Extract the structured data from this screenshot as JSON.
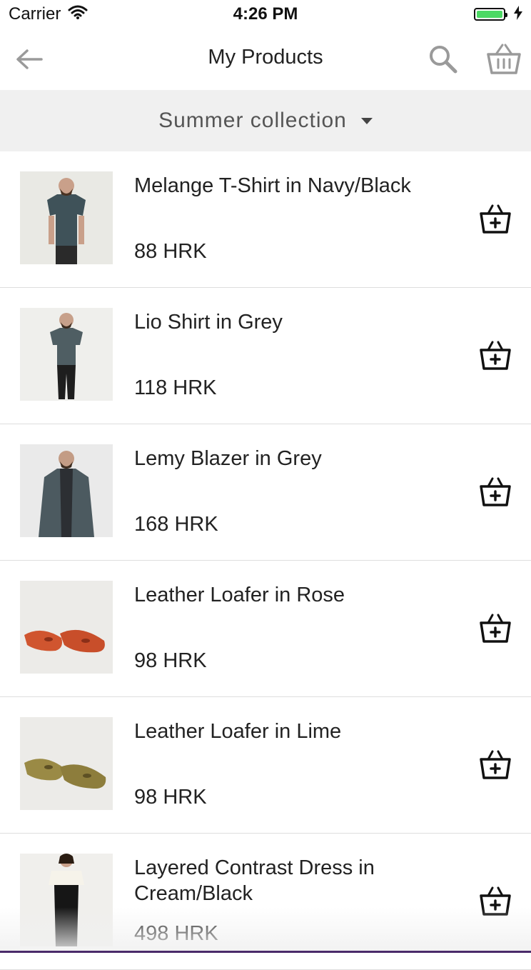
{
  "status_bar": {
    "carrier": "Carrier",
    "time": "4:26 PM",
    "battery_level": 1.0,
    "wifi_icon": "wifi-icon",
    "battery_icon": "battery-icon",
    "charging_icon": "charging-bolt-icon"
  },
  "nav": {
    "title": "My Products",
    "back_icon": "back-arrow-icon",
    "search_icon": "search-icon",
    "basket_icon": "basket-icon"
  },
  "collection": {
    "label": "Summer collection",
    "dropdown_icon": "caret-down-icon"
  },
  "products": [
    {
      "name": "Melange T-Shirt in Navy/Black",
      "price": "88 HRK",
      "image": "tshirt",
      "add_icon": "add-to-basket-icon"
    },
    {
      "name": "Lio Shirt in Grey",
      "price": "118 HRK",
      "image": "shirt",
      "add_icon": "add-to-basket-icon"
    },
    {
      "name": "Lemy Blazer in Grey",
      "price": "168 HRK",
      "image": "blazer",
      "add_icon": "add-to-basket-icon"
    },
    {
      "name": "Leather Loafer in Rose",
      "price": "98 HRK",
      "image": "loafer-rose",
      "add_icon": "add-to-basket-icon"
    },
    {
      "name": "Leather Loafer in Lime",
      "price": "98 HRK",
      "image": "loafer-lime",
      "add_icon": "add-to-basket-icon"
    },
    {
      "name": "Layered Contrast Dress in Cream/Black",
      "price": "498 HRK",
      "image": "dress",
      "add_icon": "add-to-basket-icon"
    }
  ],
  "colors": {
    "collection_bar": "#f0f0f0",
    "battery": "#4cd964",
    "icon_grey": "#9a9a9a",
    "divider": "#dedede"
  }
}
